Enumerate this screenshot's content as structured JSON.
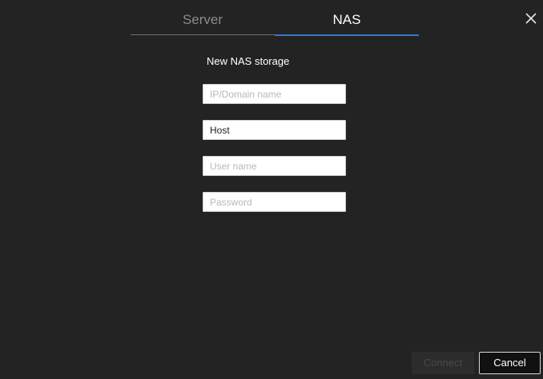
{
  "tabs": [
    {
      "label": "Server",
      "active": false
    },
    {
      "label": "NAS",
      "active": true
    }
  ],
  "close": {
    "icon": "close-icon"
  },
  "form": {
    "title": "New NAS storage",
    "ip": {
      "placeholder": "IP/Domain name",
      "value": ""
    },
    "host": {
      "placeholder": "Host",
      "value": "Host"
    },
    "user": {
      "placeholder": "User name",
      "value": ""
    },
    "password": {
      "placeholder": "Password",
      "value": ""
    }
  },
  "buttons": {
    "connect": "Connect",
    "cancel": "Cancel"
  },
  "colors": {
    "background": "#232323",
    "accent": "#2a7bd6"
  }
}
